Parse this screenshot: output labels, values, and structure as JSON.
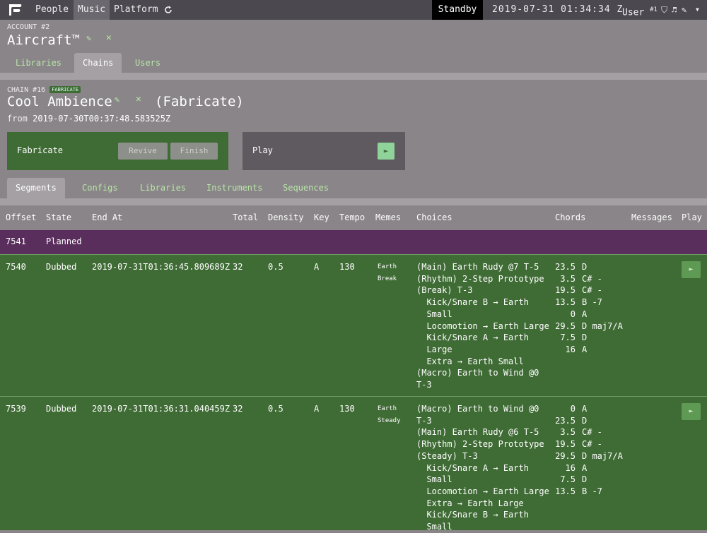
{
  "topbar": {
    "nav": [
      "People",
      "Music",
      "Platform"
    ],
    "refresh_icon": "refresh-icon",
    "standby": "Standby",
    "clock": "2019-07-31 01:34:34 Z",
    "user_label": "User",
    "user_num": "#1",
    "icons": [
      "shield-icon",
      "music-note-icon",
      "wrench-icon",
      "chevron-down-icon"
    ]
  },
  "account": {
    "label": "ACCOUNT #2",
    "name": "Aircraft™"
  },
  "account_tabs": [
    "Libraries",
    "Chains",
    "Users"
  ],
  "chain": {
    "label": "CHAIN #16",
    "badge": "FABRICATE",
    "name": "Cool Ambience",
    "mode": "(Fabricate)",
    "from_label": "from",
    "from_value": "2019-07-30T00:37:48.583525Z"
  },
  "fabricate_box": {
    "label": "Fabricate",
    "revive": "Revive",
    "finish": "Finish"
  },
  "play_box": {
    "label": "Play",
    "play_glyph": "►"
  },
  "chain_tabs": [
    "Segments",
    "Configs",
    "Libraries",
    "Instruments",
    "Sequences"
  ],
  "table": {
    "headers": [
      "Offset",
      "State",
      "End At",
      "Total",
      "Density",
      "Key",
      "Tempo",
      "Memes",
      "Choices",
      "Chords",
      "Messages",
      "Play"
    ],
    "planned": {
      "offset": "7541",
      "state": "Planned"
    },
    "rows": [
      {
        "offset": "7540",
        "state": "Dubbed",
        "end_at": "2019-07-31T01:36:45.809689Z",
        "total": "32",
        "density": "0.5",
        "key": "A",
        "tempo": "130",
        "memes": [
          "Earth",
          "Break"
        ],
        "choices": [
          "(Main) Earth Rudy @7 T-5",
          "(Rhythm) 2-Step Prototype",
          "(Break) T-3",
          "  Kick/Snare B → Earth",
          "  Small",
          "  Locomotion → Earth Large",
          "  Kick/Snare A → Earth",
          "  Large",
          "  Extra → Earth Small",
          "(Macro) Earth to Wind @0",
          "T-3"
        ],
        "chord_pos": [
          "23.5",
          "3.5",
          "19.5",
          "13.5",
          "0",
          "29.5",
          "7.5",
          "16"
        ],
        "chord_names": [
          "D",
          "C# -",
          "C# -",
          "B -7",
          "A",
          "D maj7/A",
          "D",
          "A"
        ],
        "play": "►"
      },
      {
        "offset": "7539",
        "state": "Dubbed",
        "end_at": "2019-07-31T01:36:31.040459Z",
        "total": "32",
        "density": "0.5",
        "key": "A",
        "tempo": "130",
        "memes": [
          "Earth",
          "Steady"
        ],
        "choices": [
          "(Macro) Earth to Wind @0",
          "T-3",
          "(Main) Earth Rudy @6 T-5",
          "(Rhythm) 2-Step Prototype",
          "(Steady) T-3",
          "  Kick/Snare A → Earth",
          "  Small",
          "  Locomotion → Earth Large",
          "  Extra → Earth Large",
          "  Kick/Snare B → Earth",
          "  Small"
        ],
        "chord_pos": [
          "0",
          "23.5",
          "3.5",
          "19.5",
          "29.5",
          "16",
          "7.5",
          "13.5"
        ],
        "chord_names": [
          "A",
          "D",
          "C# -",
          "C# -",
          "D maj7/A",
          "A",
          "D",
          "B -7"
        ],
        "play": "►"
      }
    ]
  }
}
